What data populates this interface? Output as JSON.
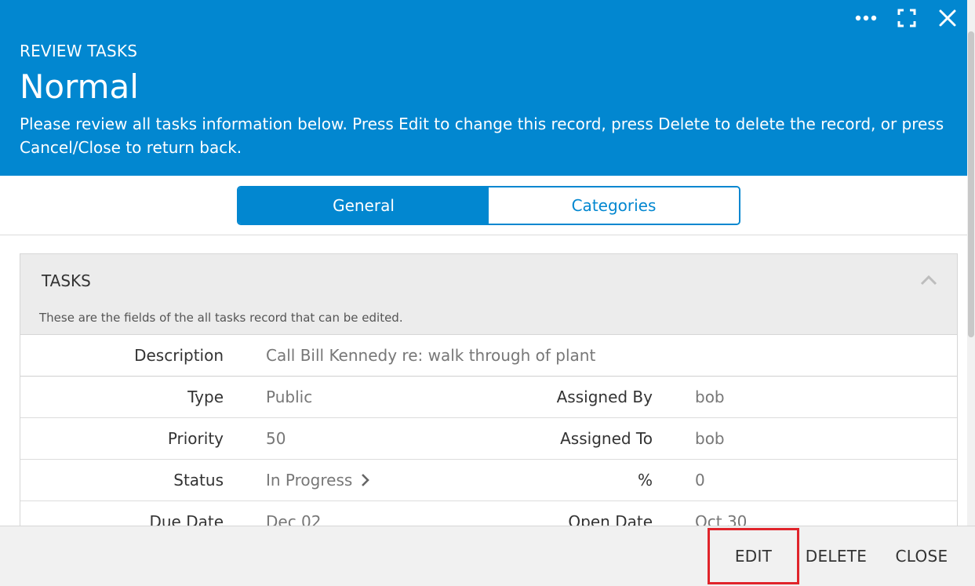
{
  "header": {
    "subtitle": "REVIEW TASKS",
    "title": "Normal",
    "description": "Please review all tasks information below. Press Edit to change this record, press Delete to delete the record, or press Cancel/Close to return back.",
    "icons": [
      "more-icon",
      "fullscreen-icon",
      "close-icon"
    ]
  },
  "tabs": [
    {
      "label": "General",
      "active": true
    },
    {
      "label": "Categories",
      "active": false
    }
  ],
  "panel": {
    "title": "TASKS",
    "subtitle": "These are the fields of the all tasks record that can be edited."
  },
  "fields": {
    "description": {
      "label": "Description",
      "value": "Call Bill Kennedy re: walk through of plant"
    },
    "type": {
      "label": "Type",
      "value": "Public"
    },
    "assigned_by": {
      "label": "Assigned By",
      "value": "bob"
    },
    "priority": {
      "label": "Priority",
      "value": "50"
    },
    "assigned_to": {
      "label": "Assigned To",
      "value": "bob"
    },
    "status": {
      "label": "Status",
      "value": "In Progress"
    },
    "percent": {
      "label": "%",
      "value": "0"
    },
    "due_date": {
      "label": "Due Date",
      "value": "Dec 02"
    },
    "open_date": {
      "label": "Open Date",
      "value": "Oct 30"
    }
  },
  "footer": {
    "edit": "EDIT",
    "delete": "DELETE",
    "close": "CLOSE"
  },
  "colors": {
    "accent": "#0287d0",
    "highlight": "#e0242b"
  }
}
